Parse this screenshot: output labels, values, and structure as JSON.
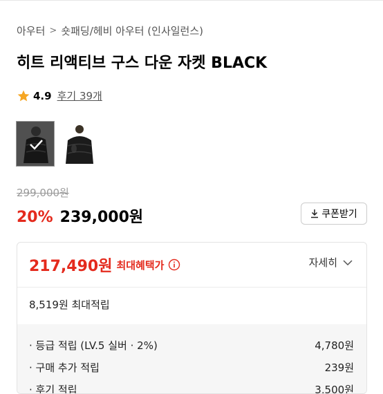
{
  "breadcrumb": {
    "first": "아우터",
    "second": "숏패딩/헤비 아우터 (인사일런스)"
  },
  "product": {
    "title": "히트 리액티브 구스 다운 자켓 BLACK"
  },
  "rating": {
    "score": "4.9",
    "review_link": "후기 39개"
  },
  "thumbnails": {
    "count": 2,
    "selected_index": 0
  },
  "pricing": {
    "original": "299,000원",
    "discount": "20%",
    "sale": "239,000원",
    "coupon_button": "쿠폰받기"
  },
  "benefit": {
    "max_price": "217,490원",
    "max_label": "최대혜택가",
    "detail_link": "자세히",
    "max_points": "8,519원 최대적립",
    "items": [
      {
        "label": "· 등급 적립 (LV.5 실버 · 2%)",
        "value": "4,780원"
      },
      {
        "label": "· 구매 추가 적립",
        "value": "239원"
      },
      {
        "label": "· 후기 적립",
        "value": "3,500원"
      }
    ]
  },
  "colors": {
    "accent_red": "#e42a1d",
    "star": "#f6a623"
  }
}
